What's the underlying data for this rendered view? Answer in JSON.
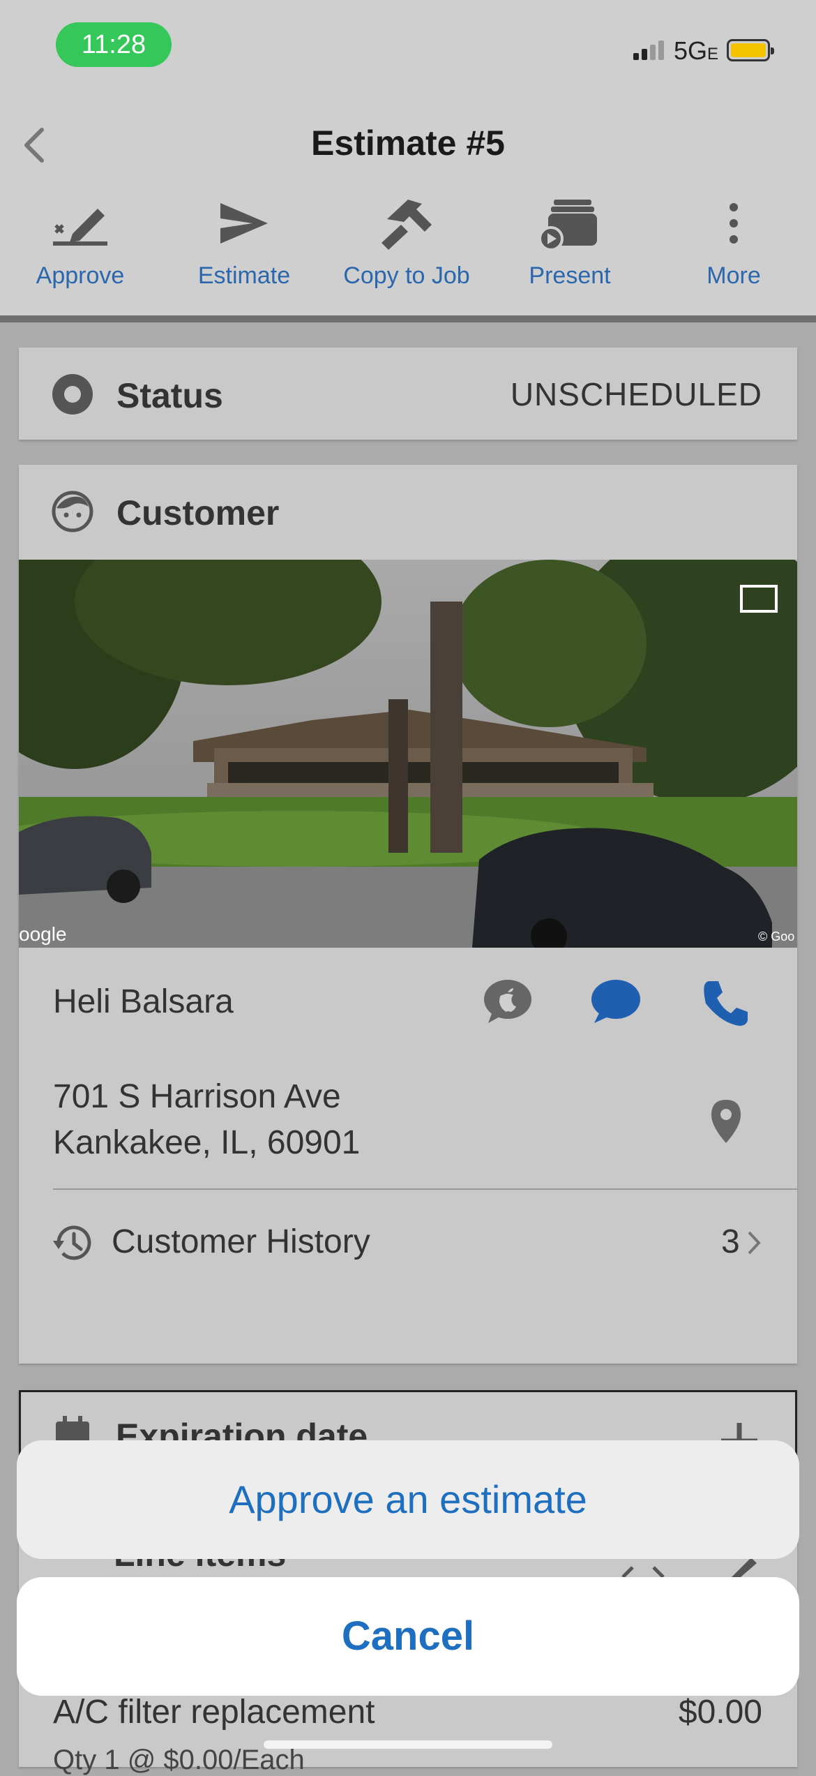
{
  "status_bar": {
    "time": "11:28",
    "network": "5G",
    "network_suffix": "E"
  },
  "header": {
    "title": "Estimate #5"
  },
  "toolbar": [
    {
      "label": "Approve",
      "icon": "approve-icon"
    },
    {
      "label": "Estimate",
      "icon": "send-icon"
    },
    {
      "label": "Copy to Job",
      "icon": "hammer-icon"
    },
    {
      "label": "Present",
      "icon": "present-icon"
    },
    {
      "label": "More",
      "icon": "more-vertical-icon"
    }
  ],
  "status": {
    "title": "Status",
    "value": "UNSCHEDULED"
  },
  "customer": {
    "title": "Customer",
    "name": "Heli Balsara",
    "address_line1": "701 S Harrison Ave",
    "address_line2": "Kankakee, IL, 60901",
    "history_label": "Customer History",
    "history_count": "3",
    "map_credit_left": "oogle",
    "map_credit_right": "© Goo"
  },
  "expiration": {
    "title": "Expiration date"
  },
  "line_items": {
    "title": "Line items",
    "item_name": "A/C filter replacement",
    "item_price": "$0.00",
    "item_detail": "Qty 1 @ $0.00/Each"
  },
  "action_sheet": {
    "approve_label": "Approve an estimate",
    "cancel_label": "Cancel"
  },
  "colors": {
    "accent": "#2a67ad",
    "sheet_blue": "#1e6fbf",
    "status_green": "#35c759",
    "battery": "#f4c400"
  }
}
